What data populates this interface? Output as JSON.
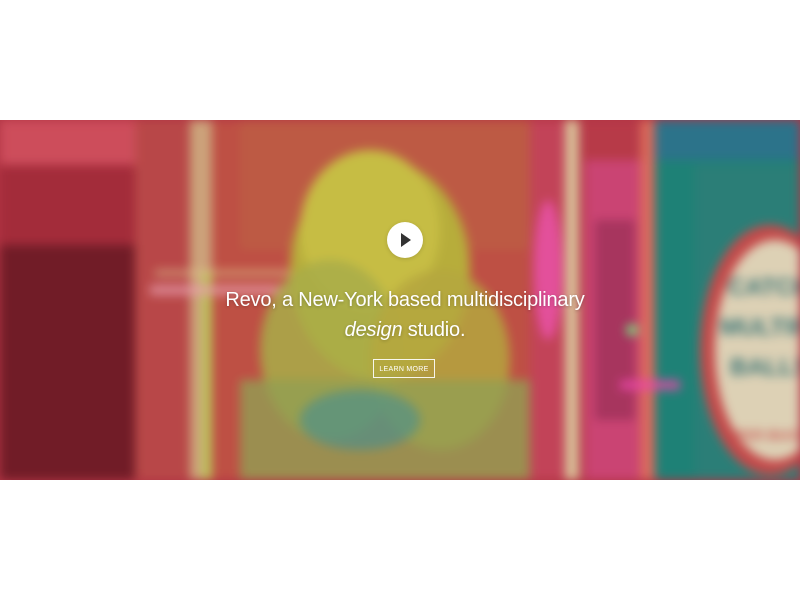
{
  "hero": {
    "headline_line1": "Revo, a New-York based multidisciplinary",
    "headline_emphasis": "design",
    "headline_rest": " studio.",
    "play_button_icon": "play-icon",
    "cta_label": "LEARN MORE",
    "background_image": "blurred photo of a blonde woman in a neon-lit arcade",
    "sign_text": "CATCH MULTIPLE BALLS PER BUCKET"
  },
  "colors": {
    "hero_red": "#c23a4a",
    "neon_pink": "#ff3fa0",
    "neon_yellow": "#e8e24a",
    "teal": "#1f8d80",
    "text": "#ffffff"
  }
}
